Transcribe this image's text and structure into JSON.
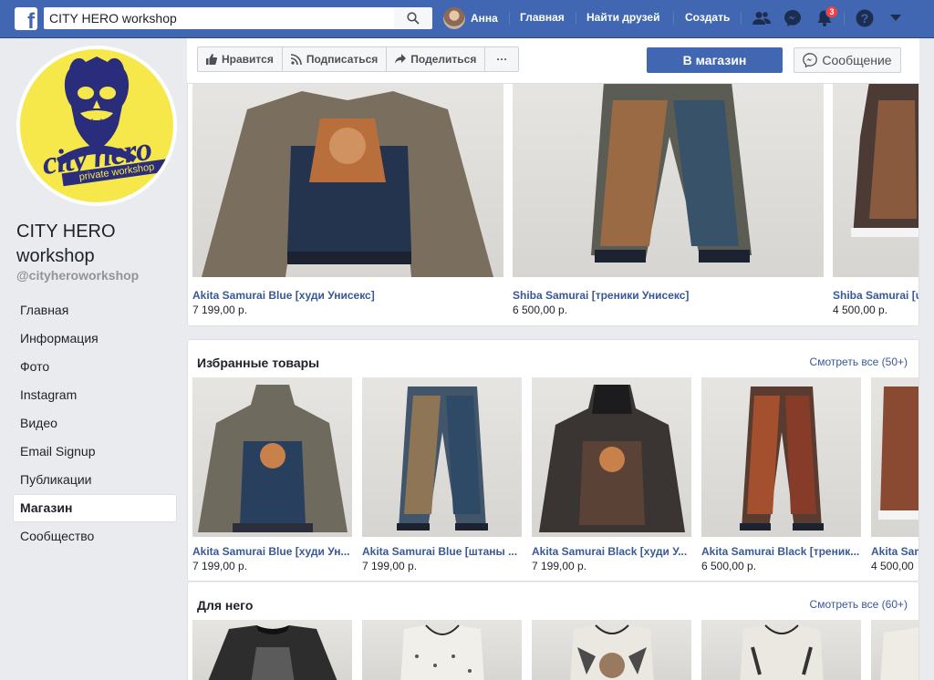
{
  "topbar": {
    "logo": "f",
    "search_value": "CITY HERO workshop",
    "user_name": "Анна",
    "nav": [
      "Главная",
      "Найти друзей",
      "Создать"
    ],
    "notification_count": "3"
  },
  "sidebar": {
    "page_name": "CITY HERO workshop",
    "handle": "@cityheroworkshop",
    "logo_text": "city hero",
    "logo_sub": "private workshop",
    "items": [
      {
        "label": "Главная"
      },
      {
        "label": "Информация"
      },
      {
        "label": "Фото"
      },
      {
        "label": "Instagram"
      },
      {
        "label": "Видео"
      },
      {
        "label": "Email Signup"
      },
      {
        "label": "Публикации"
      },
      {
        "label": "Магазин",
        "active": true
      },
      {
        "label": "Сообщество"
      }
    ]
  },
  "actions": {
    "like": "Нравится",
    "follow": "Подписаться",
    "share": "Поделиться",
    "more": "···",
    "shop": "В магазин",
    "message": "Сообщение"
  },
  "top_products": [
    {
      "name": "Akita Samurai Blue [худи Унисекс]",
      "price": "7 199,00 р."
    },
    {
      "name": "Shiba Samurai [треники Унисекс]",
      "price": "6 500,00 р."
    },
    {
      "name": "Shiba Samurai [u",
      "price": "4 500,00 р."
    }
  ],
  "featured": {
    "title": "Избранные товары",
    "see_all": "Смотреть все (50+)",
    "products": [
      {
        "name": "Akita Samurai Blue [худи Ун...",
        "price": "7 199,00 р."
      },
      {
        "name": "Akita Samurai Blue [штаны ...",
        "price": "7 199,00 р."
      },
      {
        "name": "Akita Samurai Black [худи У...",
        "price": "7 199,00 р."
      },
      {
        "name": "Akita Samurai Black [треник...",
        "price": "6 500,00 р."
      },
      {
        "name": "Akita Sam",
        "price": "4 500,00"
      }
    ]
  },
  "for_him": {
    "title": "Для него",
    "see_all": "Смотреть все (60+)"
  },
  "colors": {
    "brand_blue": "#4267b2",
    "link": "#385898",
    "logo_yellow": "#f6e84b",
    "logo_navy": "#2a2d7c"
  }
}
